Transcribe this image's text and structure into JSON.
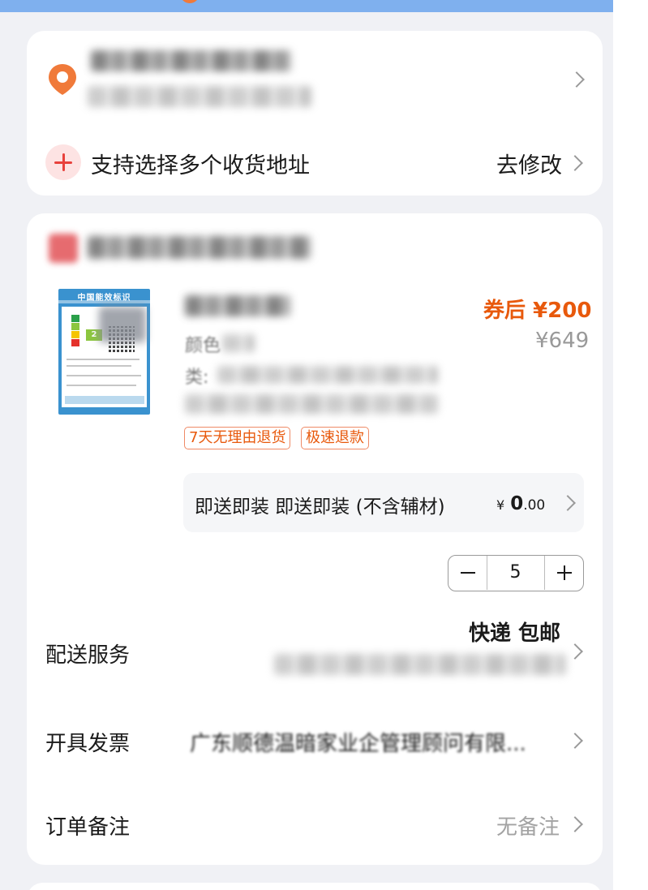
{
  "address": {
    "multi_address_label": "支持选择多个收货地址",
    "edit_label": "去修改"
  },
  "product": {
    "energy_label": {
      "title": "中国能效标识",
      "grade": "2"
    },
    "price_after_coupon": "券后 ¥200",
    "original_price": "¥649",
    "spec_color": "颜色",
    "spec_type": "类:",
    "tags": [
      "7天无理由退货",
      "极速退款"
    ]
  },
  "install_service": {
    "name": "即送即装 即送即装 (不含辅材)",
    "price_symbol": "¥",
    "price_int": "0",
    "price_dec": ".00"
  },
  "quantity": {
    "value": "5"
  },
  "delivery": {
    "label": "配送服务",
    "value": "快递 包邮"
  },
  "invoice": {
    "label": "开具发票",
    "value": "广东顺德温暗家业企管理顾问有限..."
  },
  "note": {
    "label": "订单备注",
    "value": "无备注"
  },
  "colors": {
    "accent_orange": "#e8590c",
    "pin_orange": "#f07a3a",
    "plus_red": "#e8413c",
    "top_bar_blue": "#7fb0ee"
  }
}
